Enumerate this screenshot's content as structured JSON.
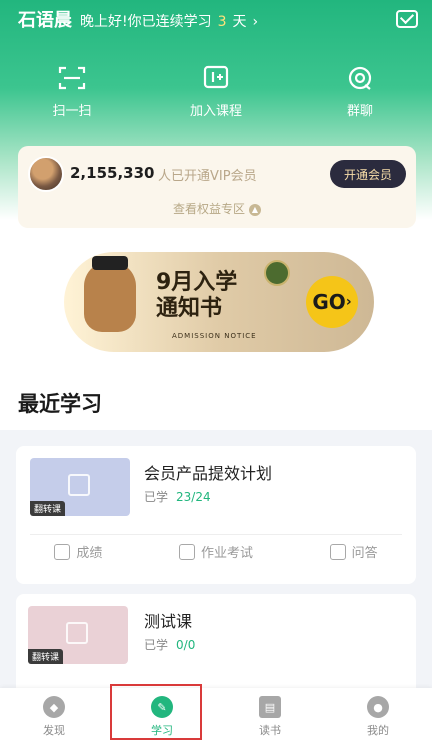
{
  "header": {
    "name": "石语晨",
    "greeting": "晚上好!你已连续学习",
    "streak_days": "3",
    "days_suffix": "天",
    "mail_icon": "mail-icon"
  },
  "actions": [
    {
      "label": "扫一扫",
      "icon": "scan-icon"
    },
    {
      "label": "加入课程",
      "icon": "add-course-icon"
    },
    {
      "label": "群聊",
      "icon": "group-chat-icon"
    }
  ],
  "vip": {
    "member_count": "2,155,330",
    "count_text": "人已开通VIP会员",
    "button": "开通会员",
    "benefits_link": "查看权益专区"
  },
  "banner": {
    "title_line1": "9月入学",
    "title_line2": "通知书",
    "subtitle": "ADMISSION NOTICE",
    "go": "GO"
  },
  "recent": {
    "title": "最近学习",
    "courses": [
      {
        "tag": "翻转课",
        "title": "会员产品提效计划",
        "progress_label": "已学",
        "progress": "23/24",
        "actions": [
          "成绩",
          "作业考试",
          "问答"
        ]
      },
      {
        "tag": "翻转课",
        "title": "测试课",
        "progress_label": "已学",
        "progress": "0/0"
      }
    ]
  },
  "tabbar": [
    {
      "label": "发现",
      "icon": "discover-icon"
    },
    {
      "label": "学习",
      "icon": "study-icon",
      "active": true
    },
    {
      "label": "读书",
      "icon": "book-icon"
    },
    {
      "label": "我的",
      "icon": "profile-icon"
    }
  ],
  "colors": {
    "accent": "#22b67e",
    "highlight_box": "#d93a3a"
  }
}
